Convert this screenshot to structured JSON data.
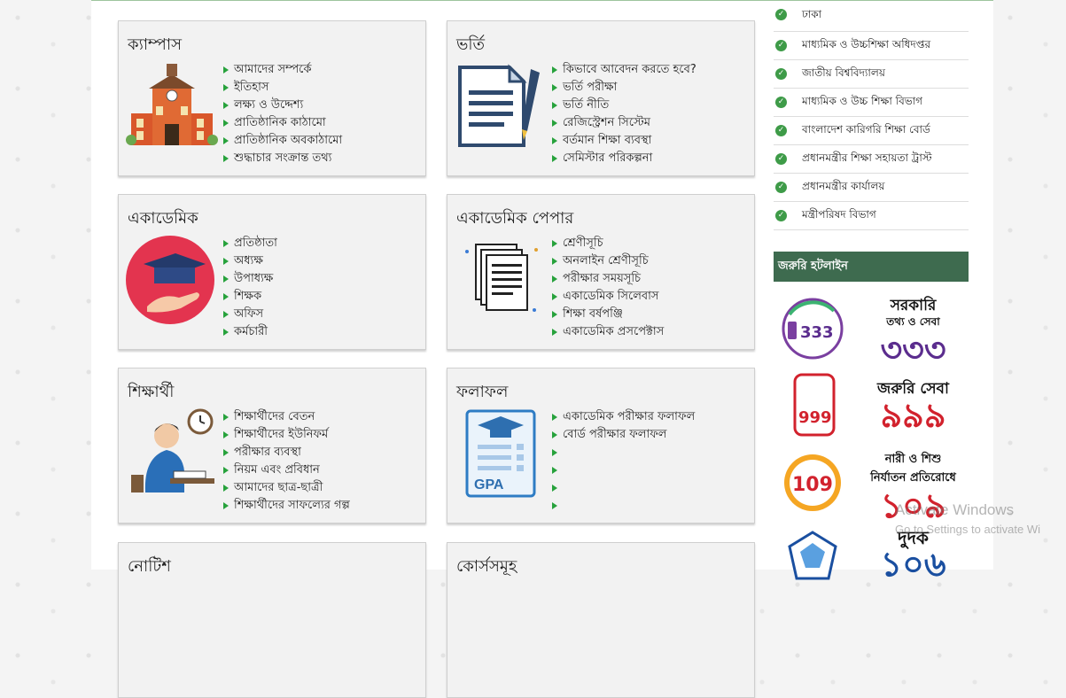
{
  "cards": {
    "campus": {
      "title": "ক্যাম্পাস",
      "links": [
        "আমাদের সম্পর্কে",
        "ইতিহাস",
        "লক্ষ্য ও উদ্দেশ্য",
        "প্রাতিষ্ঠানিক কাঠামো",
        "প্রাতিষ্ঠানিক অবকাঠামো",
        "শুদ্ধাচার সংক্রান্ত তথ্য"
      ]
    },
    "admission": {
      "title": "ভর্তি",
      "links": [
        "কিভাবে আবেদন করতে হবে?",
        "ভর্তি পরীক্ষা",
        "ভর্তি নীতি",
        "রেজিস্ট্রেশন সিস্টেম",
        "বর্তমান শিক্ষা ব্যবস্থা",
        "সেমিস্টার পরিকল্পনা"
      ]
    },
    "academic": {
      "title": "একাডেমিক",
      "links": [
        "প্রতিষ্ঠাতা",
        "অধ্যক্ষ",
        "উপাধ্যক্ষ",
        "শিক্ষক",
        "অফিস",
        "কর্মচারী"
      ]
    },
    "academic_paper": {
      "title": "একাডেমিক পেপার",
      "links": [
        "শ্রেণীসূচি",
        "অনলাইন শ্রেণীসূচি",
        "পরীক্ষার সময়সূচি",
        "একাডেমিক সিলেবাস",
        "শিক্ষা বর্ষপঞ্জি",
        "একাডেমিক প্রসপেক্টাস"
      ]
    },
    "students": {
      "title": "শিক্ষার্থী",
      "links": [
        "শিক্ষার্থীদের বেতন",
        "শিক্ষার্থীদের ইউনিফর্ম",
        "পরীক্ষার ব্যবস্থা",
        "নিয়ম এবং প্রবিধান",
        "আমাদের ছাত্র-ছাত্রী",
        "শিক্ষার্থীদের সাফল্যের গল্প"
      ]
    },
    "results": {
      "title": "ফলাফল",
      "links": [
        "একাডেমিক পরীক্ষার ফলাফল",
        "বোর্ড পরীক্ষার ফলাফল",
        "",
        "",
        "",
        ""
      ]
    },
    "notice": {
      "title": "নোটিশ"
    },
    "courses": {
      "title": "কোর্সসমূহ"
    }
  },
  "gpa_label": "GPA",
  "right_links": [
    "ঢাকা",
    "মাধ্যমিক ও উচ্চশিক্ষা অধিদপ্তর",
    "জাতীয় বিশ্ববিদ্যালয়",
    "মাধ্যমিক ও উচ্চ শিক্ষা বিভাগ",
    "বাংলাদেশ কারিগরি শিক্ষা বোর্ড",
    "প্রধানমন্ত্রীর শিক্ষা সহায়তা ট্রাস্ট",
    "প্রধানমন্ত্রীর কার্যালয়",
    "মন্ত্রীপরিষদ বিভাগ"
  ],
  "hotline": {
    "title": "জরুরি হটলাইন",
    "items": [
      {
        "logo_text": "333",
        "small": "সরকারি",
        "sub": "তথ্য ও সেবা",
        "big": "৩৩৩",
        "color": "#5b2d8e"
      },
      {
        "logo_text": "999",
        "small": "জরুরি সেবা",
        "sub": "",
        "big": "৯৯৯",
        "color": "#d2222d"
      },
      {
        "logo_text": "109",
        "small": "নারী ও শিশু",
        "sub": "নির্যাতন প্রতিরোধে",
        "big": "১০৯",
        "color": "#d2222d"
      },
      {
        "logo_text": "",
        "small": "দুদক",
        "sub": "",
        "big": "১০৬",
        "color": "#1a4fa0"
      }
    ]
  },
  "watermark": {
    "line1": "Activate Windows",
    "line2": "Go to Settings to activate Wi"
  }
}
